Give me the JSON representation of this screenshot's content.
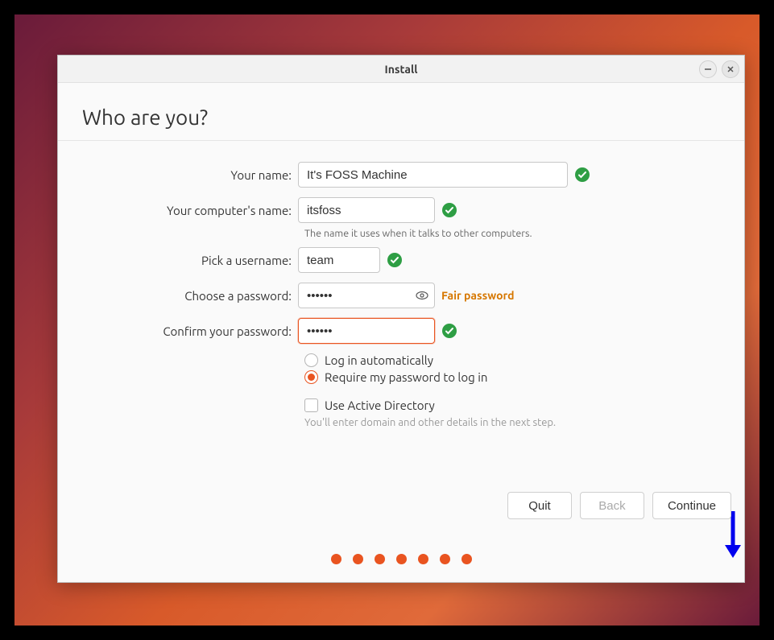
{
  "window": {
    "title": "Install"
  },
  "page": {
    "heading": "Who are you?"
  },
  "labels": {
    "yourname": "Your name:",
    "computer": "Your computer's name:",
    "computer_help": "The name it uses when it talks to other computers.",
    "username": "Pick a username:",
    "password": "Choose a password:",
    "confirm": "Confirm your password:"
  },
  "fields": {
    "yourname": "It's FOSS Machine",
    "computer": "itsfoss",
    "username": "team",
    "password": "••••••",
    "confirm": "••••••"
  },
  "password_strength": "Fair password",
  "options": {
    "auto": "Log in automatically",
    "require": "Require my password to log in",
    "ad": "Use Active Directory",
    "ad_hint": "You'll enter domain and other details in the next step."
  },
  "buttons": {
    "quit": "Quit",
    "back": "Back",
    "continue": "Continue"
  },
  "colors": {
    "accent": "#e95420",
    "success": "#2e9e44",
    "warn": "#d67700"
  }
}
